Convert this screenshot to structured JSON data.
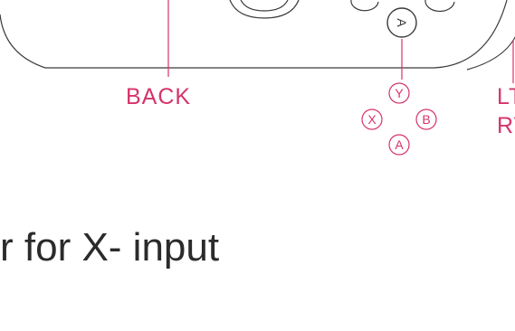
{
  "labels": {
    "back": "BACK",
    "lt": "LT",
    "rt": "RT",
    "face_buttons": {
      "y": "Y",
      "x": "X",
      "b": "B",
      "a": "A"
    },
    "controller_a_button": "A"
  },
  "caption": "r for X- input",
  "colors": {
    "accent": "#d6336c",
    "outline": "#3a3a3a",
    "text": "#2b2b2b"
  }
}
